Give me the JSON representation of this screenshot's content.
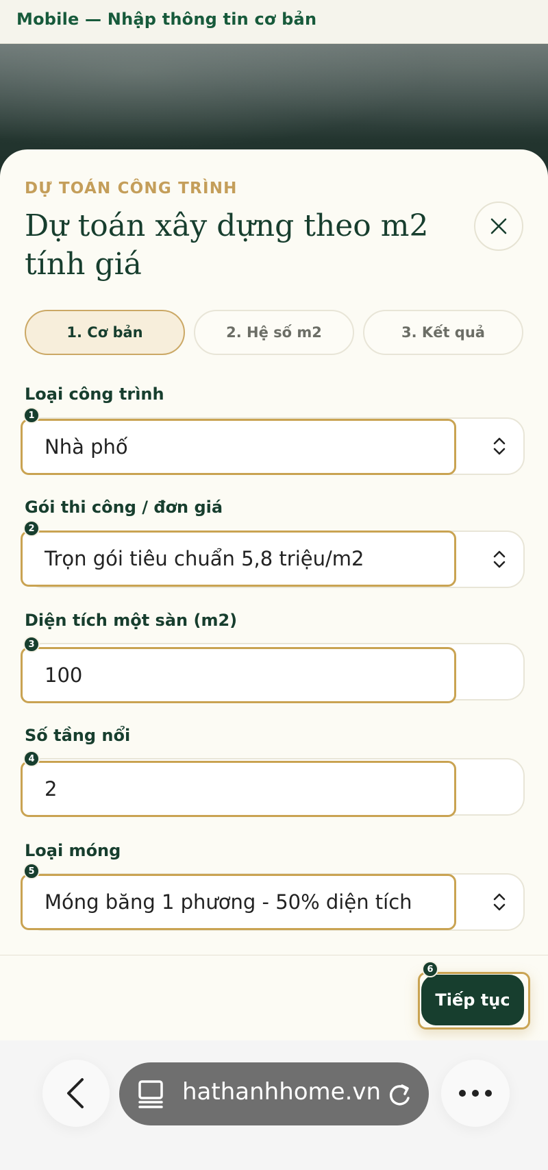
{
  "page": {
    "title": "Mobile — Nhập thông tin cơ bản"
  },
  "modal": {
    "eyebrow": "DỰ TOÁN CÔNG TRÌNH",
    "title": "Dự toán xây dựng theo m2 tính giá",
    "close_icon": "close-icon"
  },
  "tabs": [
    {
      "label": "1. Cơ bản",
      "active": true
    },
    {
      "label": "2. Hệ số m2",
      "active": false
    },
    {
      "label": "3. Kết quả",
      "active": false
    }
  ],
  "fields": [
    {
      "marker": "1",
      "label": "Loại công trình",
      "value": "Nhà phố",
      "type": "select"
    },
    {
      "marker": "2",
      "label": "Gói thi công / đơn giá",
      "value": "Trọn gói tiêu chuẩn 5,8 triệu/m2",
      "type": "select"
    },
    {
      "marker": "3",
      "label": "Diện tích một sàn (m2)",
      "value": "100",
      "type": "number"
    },
    {
      "marker": "4",
      "label": "Số tầng nổi",
      "value": "2",
      "type": "number"
    },
    {
      "marker": "5",
      "label": "Loại móng",
      "value": "Móng băng 1 phương - 50% diện tích",
      "type": "select"
    }
  ],
  "footer": {
    "marker": "6",
    "continue_label": "Tiếp tục"
  },
  "browser": {
    "url": "hathanhhome.vn",
    "icons": [
      "back-icon",
      "tabs-icon",
      "reload-icon",
      "more-icon"
    ]
  },
  "colors": {
    "primary": "#173e2e",
    "accent": "#c9a352",
    "eyebrow": "#c49e5a",
    "sheet": "#fcfbf4"
  }
}
